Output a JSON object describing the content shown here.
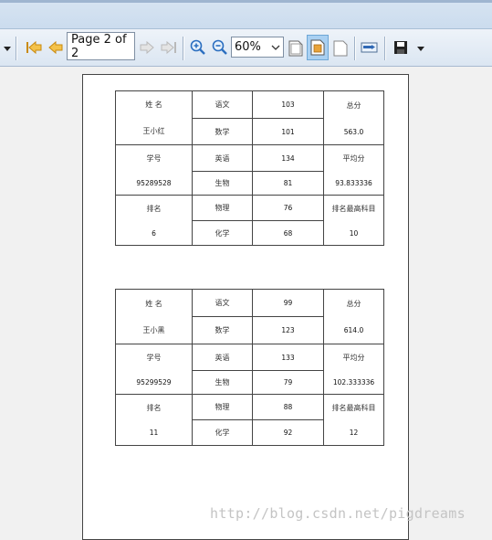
{
  "toolbar": {
    "page_field": "Page 2 of 2",
    "zoom_value": "60%"
  },
  "records": [
    {
      "name_label": "姓 名",
      "name_value": "王小红",
      "id_label": "学号",
      "id_value": "95289528",
      "rank_label": "排名",
      "rank_value": "6",
      "subjects": [
        {
          "name": "语文",
          "score": "103"
        },
        {
          "name": "数学",
          "score": "101"
        },
        {
          "name": "英语",
          "score": "134"
        },
        {
          "name": "生物",
          "score": "81"
        },
        {
          "name": "物理",
          "score": "76"
        },
        {
          "name": "化学",
          "score": "68"
        }
      ],
      "total_label": "总分",
      "total_value": "563.0",
      "avg_label": "平均分",
      "avg_value": "93.833336",
      "top_label": "排名最高科目",
      "top_value": "10"
    },
    {
      "name_label": "姓 名",
      "name_value": "王小黑",
      "id_label": "学号",
      "id_value": "95299529",
      "rank_label": "排名",
      "rank_value": "11",
      "subjects": [
        {
          "name": "语文",
          "score": "99"
        },
        {
          "name": "数学",
          "score": "123"
        },
        {
          "name": "英语",
          "score": "133"
        },
        {
          "name": "生物",
          "score": "79"
        },
        {
          "name": "物理",
          "score": "88"
        },
        {
          "name": "化学",
          "score": "92"
        }
      ],
      "total_label": "总分",
      "total_value": "614.0",
      "avg_label": "平均分",
      "avg_value": "102.333336",
      "top_label": "排名最高科目",
      "top_value": "12"
    }
  ],
  "watermark": "http://blog.csdn.net/pigdreams",
  "colors": {
    "toolbar_bg": "#dbe6f2",
    "nav_arrow": "#e3a21a",
    "zoom_icon": "#2c6fc0",
    "active_button": "#a9d0f2"
  }
}
